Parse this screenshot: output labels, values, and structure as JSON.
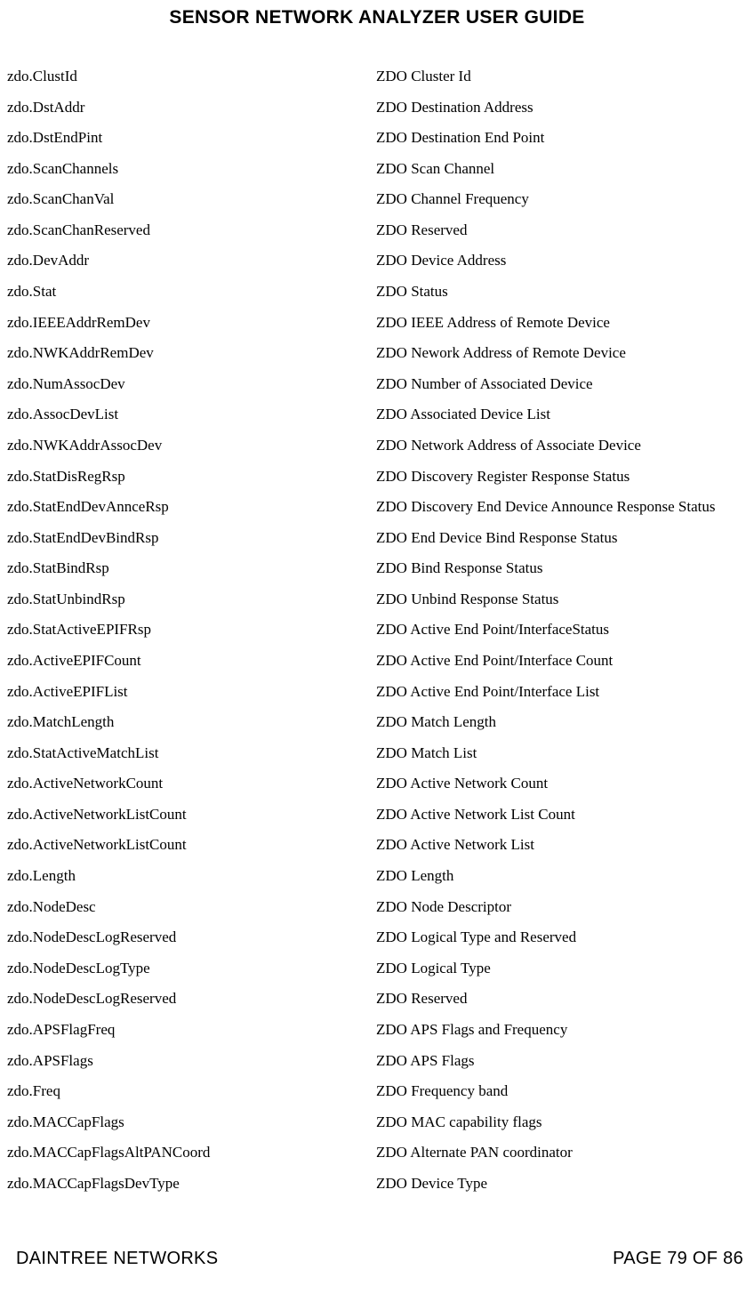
{
  "title": "SENSOR NETWORK ANALYZER USER GUIDE",
  "rows": [
    {
      "key": "zdo.ClustId",
      "desc": "ZDO Cluster Id"
    },
    {
      "key": "zdo.DstAddr",
      "desc": "ZDO Destination Address"
    },
    {
      "key": "zdo.DstEndPint",
      "desc": "ZDO Destination End Point"
    },
    {
      "key": "zdo.ScanChannels",
      "desc": "ZDO Scan Channel"
    },
    {
      "key": "zdo.ScanChanVal",
      "desc": "ZDO Channel Frequency"
    },
    {
      "key": "zdo.ScanChanReserved",
      "desc": "ZDO Reserved"
    },
    {
      "key": "zdo.DevAddr",
      "desc": "ZDO Device Address"
    },
    {
      "key": "zdo.Stat",
      "desc": "ZDO Status"
    },
    {
      "key": "zdo.IEEEAddrRemDev",
      "desc": "ZDO IEEE Address of Remote Device"
    },
    {
      "key": "zdo.NWKAddrRemDev",
      "desc": "ZDO Nework Address of Remote Device"
    },
    {
      "key": "zdo.NumAssocDev",
      "desc": "ZDO Number of Associated Device"
    },
    {
      "key": "zdo.AssocDevList",
      "desc": "ZDO Associated Device List"
    },
    {
      "key": "zdo.NWKAddrAssocDev",
      "desc": "ZDO Network Address of Associate Device"
    },
    {
      "key": "zdo.StatDisRegRsp",
      "desc": "ZDO Discovery Register Response Status"
    },
    {
      "key": "zdo.StatEndDevAnnceRsp",
      "desc": "ZDO Discovery End Device Announce Response Status"
    },
    {
      "key": "zdo.StatEndDevBindRsp",
      "desc": "ZDO End Device Bind Response Status"
    },
    {
      "key": "zdo.StatBindRsp",
      "desc": "ZDO Bind Response Status"
    },
    {
      "key": "zdo.StatUnbindRsp",
      "desc": "ZDO Unbind Response Status"
    },
    {
      "key": "zdo.StatActiveEPIFRsp",
      "desc": "ZDO Active End Point/InterfaceStatus"
    },
    {
      "key": "zdo.ActiveEPIFCount",
      "desc": "ZDO Active End Point/Interface Count"
    },
    {
      "key": "zdo.ActiveEPIFList",
      "desc": "ZDO Active End Point/Interface List"
    },
    {
      "key": "zdo.MatchLength",
      "desc": "ZDO Match Length"
    },
    {
      "key": "zdo.StatActiveMatchList",
      "desc": "ZDO Match List"
    },
    {
      "key": "zdo.ActiveNetworkCount",
      "desc": "ZDO Active Network Count"
    },
    {
      "key": "zdo.ActiveNetworkListCount",
      "desc": "ZDO Active Network List Count"
    },
    {
      "key": "zdo.ActiveNetworkListCount",
      "desc": "ZDO Active Network List"
    },
    {
      "key": "zdo.Length",
      "desc": "ZDO Length"
    },
    {
      "key": "zdo.NodeDesc",
      "desc": "ZDO Node Descriptor"
    },
    {
      "key": "zdo.NodeDescLogReserved",
      "desc": "ZDO Logical Type and Reserved"
    },
    {
      "key": "zdo.NodeDescLogType",
      "desc": "ZDO Logical Type"
    },
    {
      "key": "zdo.NodeDescLogReserved",
      "desc": "ZDO Reserved"
    },
    {
      "key": "zdo.APSFlagFreq",
      "desc": "ZDO APS Flags and Frequency"
    },
    {
      "key": "zdo.APSFlags",
      "desc": "ZDO APS Flags"
    },
    {
      "key": "zdo.Freq",
      "desc": "ZDO Frequency band"
    },
    {
      "key": "zdo.MACCapFlags",
      "desc": "ZDO MAC capability flags"
    },
    {
      "key": "zdo.MACCapFlagsAltPANCoord",
      "desc": "ZDO Alternate PAN coordinator"
    },
    {
      "key": "zdo.MACCapFlagsDevType",
      "desc": "ZDO Device Type"
    }
  ],
  "footer": {
    "left": "DAINTREE NETWORKS",
    "right": "PAGE 79 OF 86"
  }
}
